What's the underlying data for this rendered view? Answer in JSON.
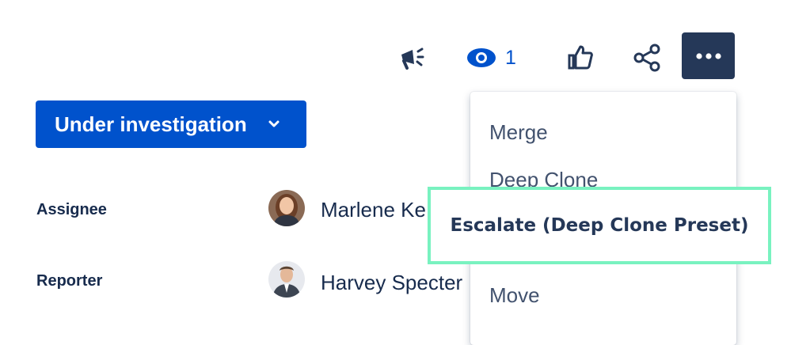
{
  "toolbar": {
    "announce_icon": "megaphone-icon",
    "watch_icon": "eye-icon",
    "watch_count": "1",
    "like_icon": "thumbs-up-icon",
    "share_icon": "share-icon",
    "more_icon": "more-horizontal-icon"
  },
  "status": {
    "label": "Under investigation",
    "icon": "chevron-down-icon"
  },
  "fields": [
    {
      "label": "Assignee",
      "name": "Marlene Ke"
    },
    {
      "label": "Reporter",
      "name": "Harvey Specter"
    }
  ],
  "menu": {
    "items": [
      "Merge",
      "Deep Clone",
      "Move"
    ],
    "highlighted": "Escalate (Deep Clone Preset)"
  },
  "colors": {
    "primary": "#0052CC",
    "more_button": "#253858",
    "highlight_border": "#79F2C0"
  }
}
